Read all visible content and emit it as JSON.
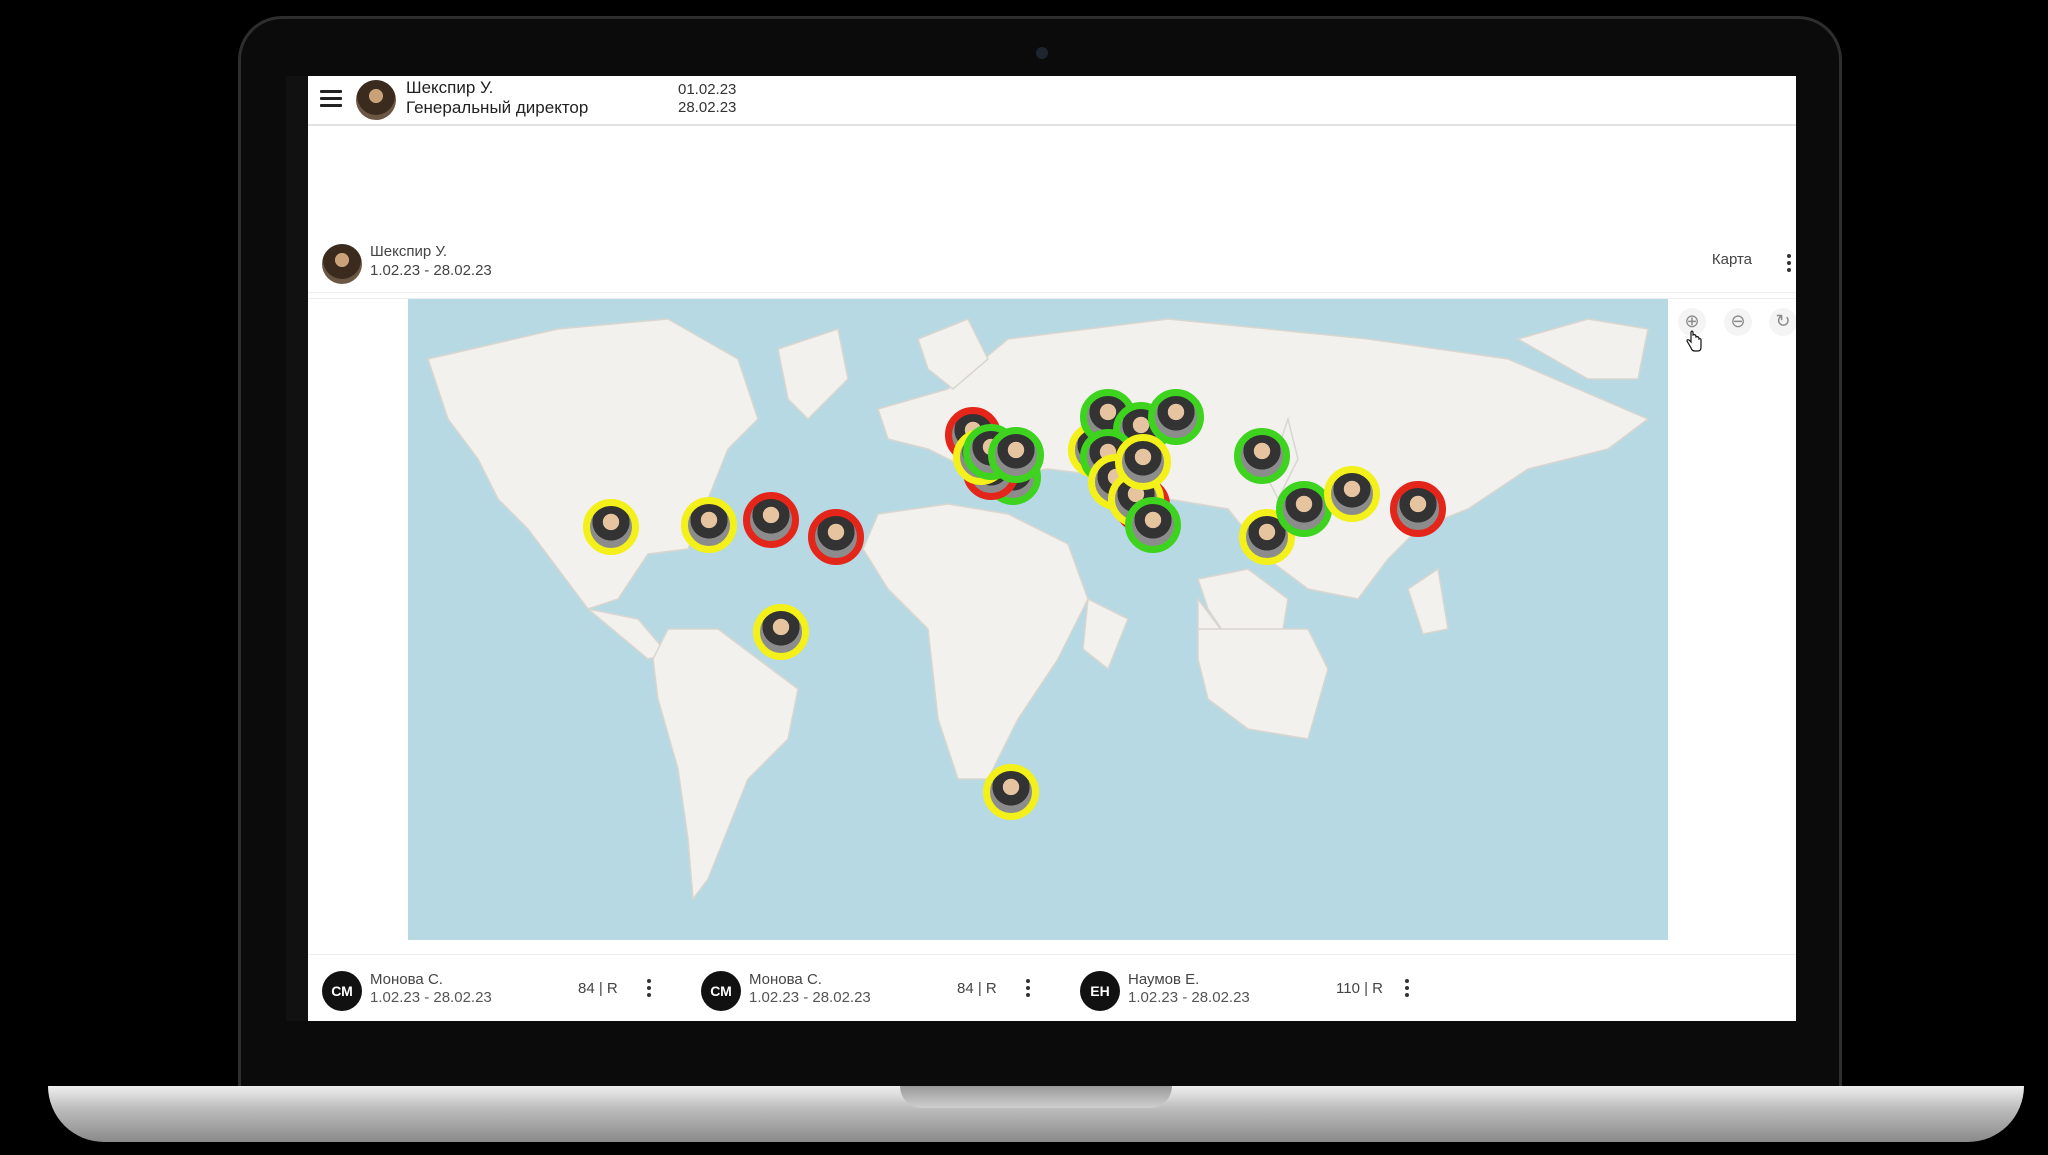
{
  "header": {
    "user_name": "Шекспир У.",
    "user_role": "Генеральный директор",
    "date_from": "01.02.23",
    "date_to": "28.02.23"
  },
  "card": {
    "user_name": "Шекспир У.",
    "date_range": "1.02.23 - 28.02.23",
    "view_label": "Карта"
  },
  "map_controls": {
    "zoom_in_icon": "zoom-in-icon",
    "zoom_out_icon": "zoom-out-icon",
    "reset_icon": "refresh-icon"
  },
  "status_colors": {
    "green": "#3ed31f",
    "yellow": "#f4f01a",
    "red": "#e3251a"
  },
  "footer_cards": [
    {
      "initials": "СМ",
      "name": "Монова С.",
      "date_range": "1.02.23 - 28.02.23",
      "score": "84 | R"
    },
    {
      "initials": "СМ",
      "name": "Монова С.",
      "date_range": "1.02.23 - 28.02.23",
      "score": "84 | R"
    },
    {
      "initials": "ЕН",
      "name": "Наумов Е.",
      "date_range": "1.02.23 - 28.02.23",
      "score": "110 | R"
    }
  ]
}
